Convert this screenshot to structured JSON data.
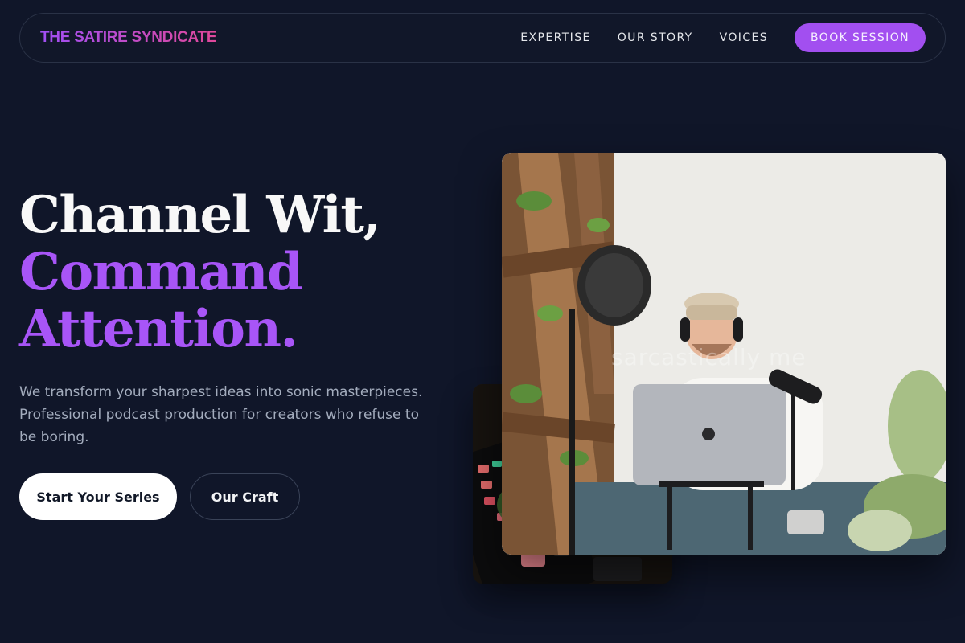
{
  "nav": {
    "brand": "THE SATIRE SYNDICATE",
    "links": [
      "EXPERTISE",
      "OUR STORY",
      "VOICES"
    ],
    "cta": "BOOK SESSION"
  },
  "hero": {
    "title_line1": "Channel Wit,",
    "title_line2": "Command",
    "title_line3": "Attention.",
    "subtitle": "We transform your sharpest ideas into sonic masterpieces. Professional podcast production for creators who refuse to be boring.",
    "primary_button": "Start Your Series",
    "secondary_button": "Our Craft"
  },
  "images": {
    "main_watermark": "sarcastically me"
  },
  "colors": {
    "background": "#101629",
    "accent": "#a855f7",
    "button_accent": "#a24ff0",
    "brand_gradient_start": "#a04ff5",
    "brand_gradient_end": "#e0489a"
  }
}
